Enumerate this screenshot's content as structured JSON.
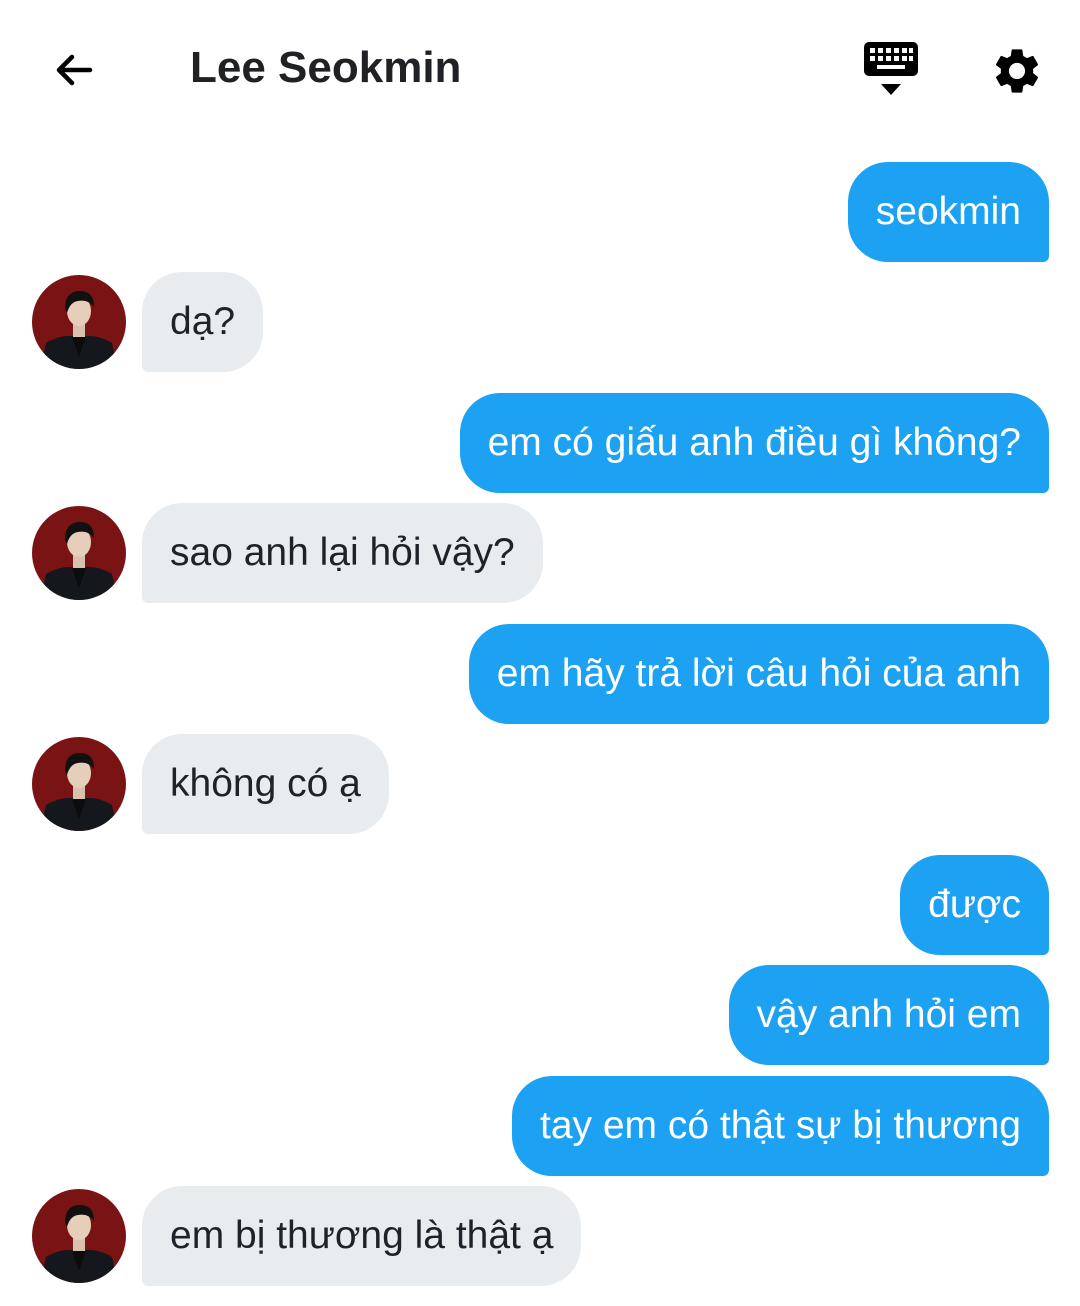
{
  "header": {
    "title": "Lee Seokmin",
    "back_icon": "arrow-left-icon",
    "keyboard_icon": "keyboard-hide-icon",
    "settings_icon": "gear-icon"
  },
  "colors": {
    "sent_bubble": "#1da1f2",
    "received_bubble": "#e8ecef",
    "avatar_background": "#7a1414"
  },
  "messages": [
    {
      "side": "sent",
      "text": "seokmin"
    },
    {
      "side": "received",
      "text": "dạ?"
    },
    {
      "side": "sent",
      "text": "em có giấu anh điều gì không?"
    },
    {
      "side": "received",
      "text": "sao anh lại hỏi vậy?"
    },
    {
      "side": "sent",
      "text": "em hãy trả lời câu hỏi của anh"
    },
    {
      "side": "received",
      "text": "không có ạ"
    },
    {
      "side": "sent",
      "text": "được"
    },
    {
      "side": "sent",
      "text": "vậy anh hỏi em"
    },
    {
      "side": "sent",
      "text": "tay em có thật sự bị thương"
    },
    {
      "side": "received",
      "text": "em bị thương là thật ạ"
    }
  ]
}
